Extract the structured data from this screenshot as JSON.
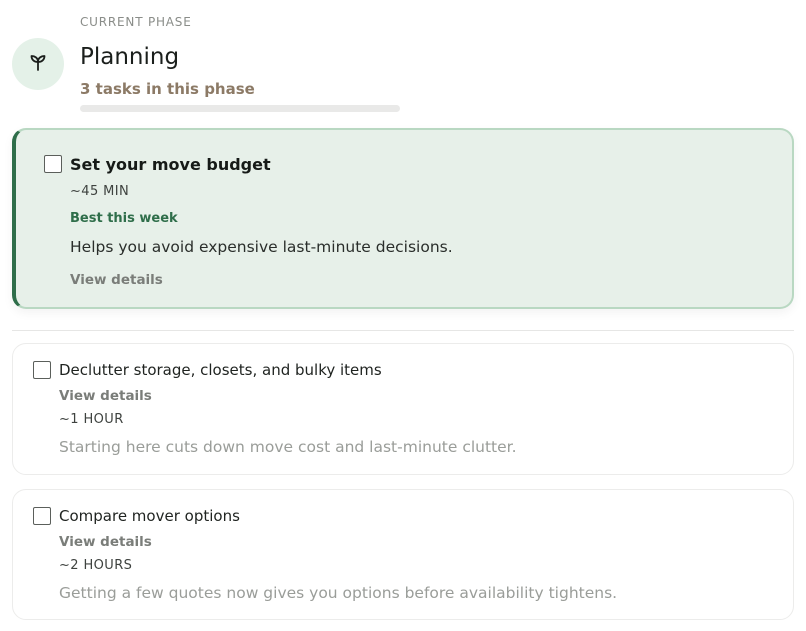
{
  "phase": {
    "eyebrow": "CURRENT PHASE",
    "icon": "sprout-icon",
    "title": "Planning",
    "task_count": "3 tasks in this phase",
    "progress": 0
  },
  "colors": {
    "accent": "#2f6e4a",
    "featured_bg": "#e7f0e9",
    "count_text": "#8c7a66"
  },
  "featured_task": {
    "title": "Set your move budget",
    "time": "~45 MIN",
    "badge": "Best this week",
    "description": "Helps you avoid expensive last-minute decisions.",
    "link": "View details",
    "checked": false
  },
  "tasks": [
    {
      "title": "Declutter storage, closets, and bulky items",
      "link": "View details",
      "time": "~1 HOUR",
      "description": "Starting here cuts down move cost and last-minute clutter.",
      "checked": false
    },
    {
      "title": "Compare mover options",
      "link": "View details",
      "time": "~2 HOURS",
      "description": "Getting a few quotes now gives you options before availability tightens.",
      "checked": false
    }
  ]
}
